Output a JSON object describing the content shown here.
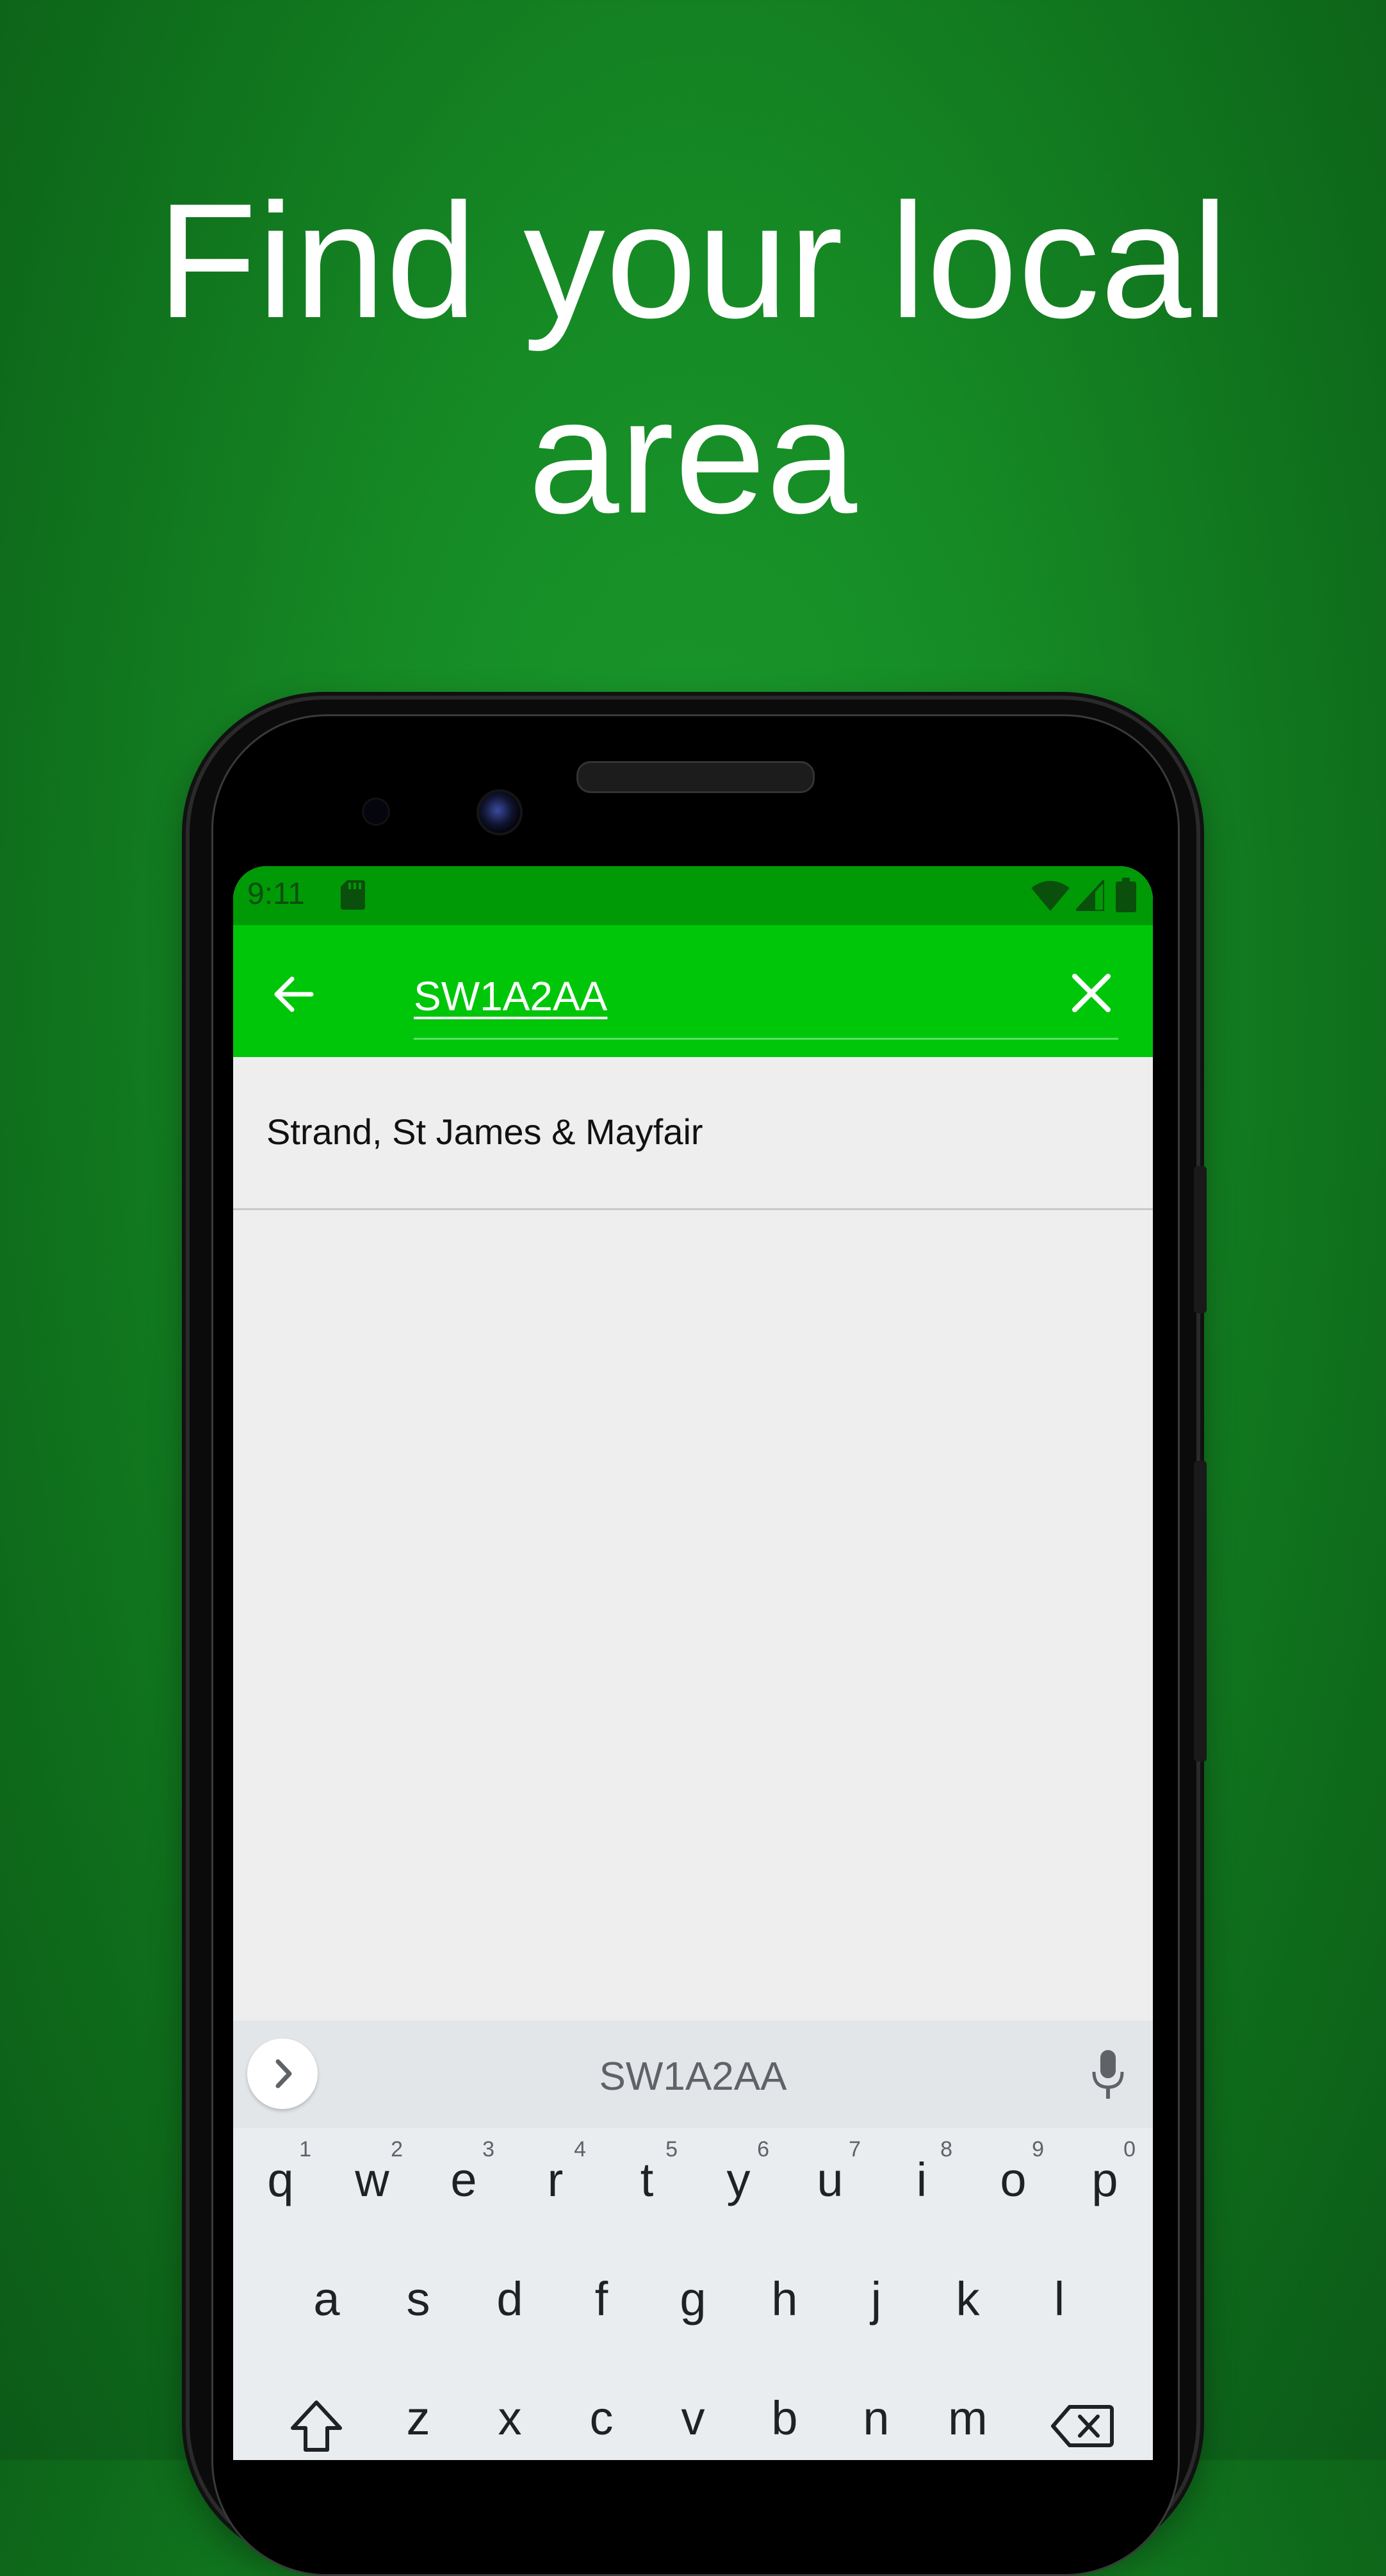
{
  "headline": {
    "line1": "Find your local",
    "line2": "area"
  },
  "status_bar": {
    "time": "9:11"
  },
  "search": {
    "query": "SW1A2AA"
  },
  "results": [
    {
      "label": "Strand, St James & Mayfair"
    }
  ],
  "keyboard": {
    "suggestion": "SW1A2AA",
    "row1": [
      {
        "key": "q",
        "hint": "1"
      },
      {
        "key": "w",
        "hint": "2"
      },
      {
        "key": "e",
        "hint": "3"
      },
      {
        "key": "r",
        "hint": "4"
      },
      {
        "key": "t",
        "hint": "5"
      },
      {
        "key": "y",
        "hint": "6"
      },
      {
        "key": "u",
        "hint": "7"
      },
      {
        "key": "i",
        "hint": "8"
      },
      {
        "key": "o",
        "hint": "9"
      },
      {
        "key": "p",
        "hint": "0"
      }
    ],
    "row2": [
      "a",
      "s",
      "d",
      "f",
      "g",
      "h",
      "j",
      "k",
      "l"
    ],
    "row3": [
      "z",
      "x",
      "c",
      "v",
      "b",
      "n",
      "m"
    ]
  },
  "colors": {
    "background": "#168a25",
    "status_bar": "#009a06",
    "app_bar": "#00c60a",
    "screen": "#eeeeee",
    "keyboard": "#e9edf0"
  },
  "icons": {
    "back": "arrow-left-icon",
    "clear": "close-icon",
    "mic": "mic-icon",
    "expand": "chevron-right-icon",
    "shift": "shift-icon",
    "backspace": "backspace-icon"
  }
}
